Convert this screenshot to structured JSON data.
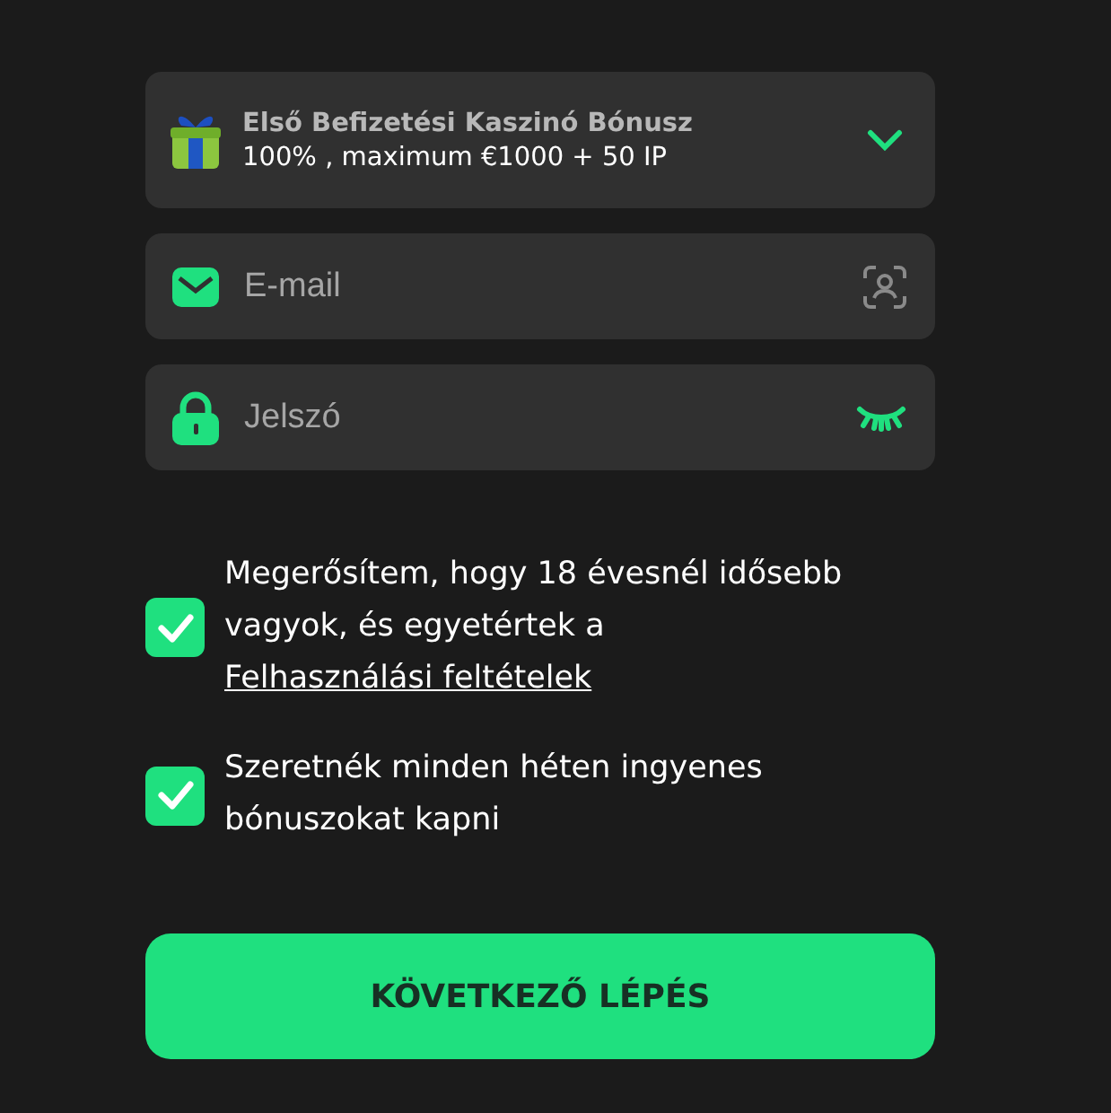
{
  "bonus": {
    "title": "Első Befizetési Kaszinó Bónusz",
    "subtitle": "100% , maximum €1000 + 50 IP",
    "expanded": false
  },
  "fields": [
    {
      "kind": "email",
      "placeholder": "E-mail"
    },
    {
      "kind": "password",
      "placeholder": "Jelszó"
    }
  ],
  "consents": [
    {
      "text": "Megerősítem, hogy 18 évesnél idősebb vagyok, és egyetértek a",
      "link": "Felhasználási feltételek",
      "checked": true
    },
    {
      "text": "Szeretnék minden héten ingyenes bónuszokat kapni",
      "checked": true
    }
  ],
  "button": {
    "label": "KÖVETKEZŐ LÉPÉS"
  }
}
